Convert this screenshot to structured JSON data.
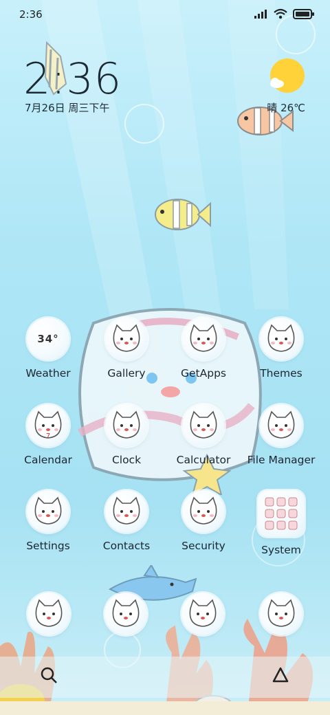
{
  "status_bar": {
    "time": "2:36"
  },
  "clock": {
    "time": "2:36",
    "date": "7月26日 周三下午"
  },
  "weather": {
    "condition_temp": "晴 26℃"
  },
  "apps": [
    {
      "label": "Weather",
      "icon": "weather-icon",
      "glyph": "34°"
    },
    {
      "label": "Gallery",
      "icon": "gallery-icon"
    },
    {
      "label": "GetApps",
      "icon": "getapps-icon"
    },
    {
      "label": "Themes",
      "icon": "themes-icon"
    },
    {
      "label": "Calendar",
      "icon": "calendar-icon",
      "glyph": "7"
    },
    {
      "label": "Clock",
      "icon": "clock-icon"
    },
    {
      "label": "Calculator",
      "icon": "calculator-icon"
    },
    {
      "label": "File Manager",
      "icon": "file-manager-icon"
    },
    {
      "label": "Settings",
      "icon": "settings-icon"
    },
    {
      "label": "Contacts",
      "icon": "contacts-icon"
    },
    {
      "label": "Security",
      "icon": "security-icon"
    },
    {
      "label": "System",
      "icon": "system-folder-icon"
    }
  ],
  "dock_apps": [
    {
      "icon": "phone-icon"
    },
    {
      "icon": "messages-icon"
    },
    {
      "icon": "browser-icon"
    },
    {
      "icon": "camera-icon"
    }
  ],
  "colors": {
    "sea_top": "#c8f0fb",
    "sea_bottom": "#a6e2f3",
    "sun": "#ffd23a",
    "text": "#1e2a33"
  }
}
